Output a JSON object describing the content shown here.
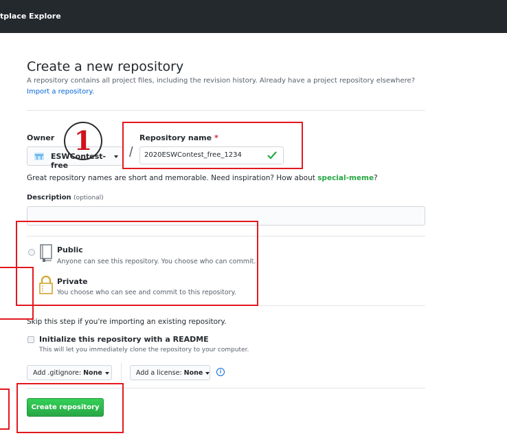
{
  "nav": {
    "items": [
      "tplace",
      "Explore"
    ]
  },
  "header": {
    "title": "Create a new repository",
    "subtitle": "A repository contains all project files, including the revision history. Already have a project repository elsewhere?",
    "import_link": "Import a repository."
  },
  "form": {
    "owner_label": "Owner",
    "owner_value": "ESWContest-free",
    "slash": "/",
    "repo_label": "Repository name",
    "required_mark": "*",
    "repo_value": "2020ESWContest_free_1234",
    "hint_prefix": "Great repository names are short and memorable. Need inspiration? How about ",
    "hint_suggestion": "special-meme",
    "hint_suffix": "?",
    "description_label": "Description",
    "description_optional": "(optional)",
    "description_value": ""
  },
  "visibility": {
    "public_title": "Public",
    "public_desc": "Anyone can see this repository. You choose who can commit.",
    "private_title": "Private",
    "private_desc": "You choose who can see and commit to this repository."
  },
  "init": {
    "skip_text": "Skip this step if you're importing an existing repository.",
    "readme_label": "Initialize this repository with a README",
    "readme_desc": "This will let you immediately clone the repository to your computer.",
    "gitignore_prefix": "Add .gitignore:",
    "gitignore_value": "None",
    "license_prefix": "Add a license:",
    "license_value": "None",
    "info_glyph": "i"
  },
  "submit": {
    "label": "Create repository"
  },
  "annotation": {
    "step_number": "1"
  },
  "colors": {
    "accent_red": "#e3171d",
    "check_green": "#28a745",
    "link_blue": "#0366d6"
  }
}
